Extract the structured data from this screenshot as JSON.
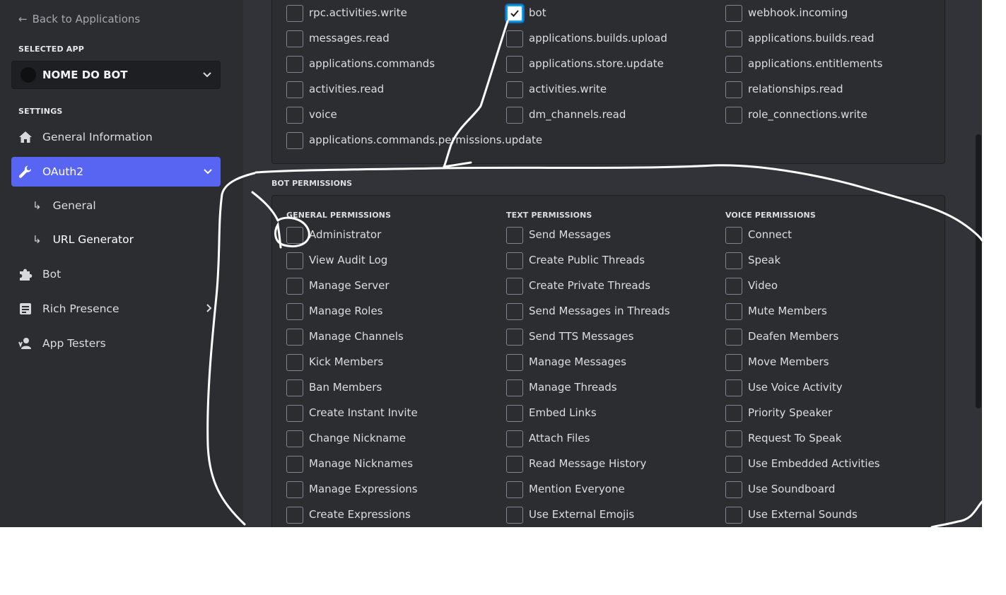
{
  "sidebar": {
    "back_label": "Back to Applications",
    "selected_app_heading": "SELECTED APP",
    "selected_app_name": "NOME DO BOT",
    "settings_heading": "SETTINGS",
    "items": [
      {
        "label": "General Information",
        "icon": "home-icon"
      },
      {
        "label": "OAuth2",
        "icon": "wrench-icon",
        "active": true
      },
      {
        "label": "Bot",
        "icon": "puzzle-icon"
      },
      {
        "label": "Rich Presence",
        "icon": "document-icon"
      },
      {
        "label": "App Testers",
        "icon": "user-icon"
      }
    ],
    "oauth_sub": [
      "General",
      "URL Generator"
    ]
  },
  "scopes": [
    {
      "label": "rpc.activities.write",
      "checked": false
    },
    {
      "label": "bot",
      "checked": true
    },
    {
      "label": "webhook.incoming",
      "checked": false
    },
    {
      "label": "messages.read",
      "checked": false
    },
    {
      "label": "applications.builds.upload",
      "checked": false
    },
    {
      "label": "applications.builds.read",
      "checked": false
    },
    {
      "label": "applications.commands",
      "checked": false
    },
    {
      "label": "applications.store.update",
      "checked": false
    },
    {
      "label": "applications.entitlements",
      "checked": false
    },
    {
      "label": "activities.read",
      "checked": false
    },
    {
      "label": "activities.write",
      "checked": false
    },
    {
      "label": "relationships.read",
      "checked": false
    },
    {
      "label": "voice",
      "checked": false
    },
    {
      "label": "dm_channels.read",
      "checked": false
    },
    {
      "label": "role_connections.write",
      "checked": false
    },
    {
      "label": "applications.commands.permissions.update",
      "checked": false
    }
  ],
  "bot_permissions": {
    "title": "BOT PERMISSIONS",
    "groups": [
      {
        "heading": "GENERAL PERMISSIONS",
        "items": [
          "Administrator",
          "View Audit Log",
          "Manage Server",
          "Manage Roles",
          "Manage Channels",
          "Kick Members",
          "Ban Members",
          "Create Instant Invite",
          "Change Nickname",
          "Manage Nicknames",
          "Manage Expressions",
          "Create Expressions"
        ]
      },
      {
        "heading": "TEXT PERMISSIONS",
        "items": [
          "Send Messages",
          "Create Public Threads",
          "Create Private Threads",
          "Send Messages in Threads",
          "Send TTS Messages",
          "Manage Messages",
          "Manage Threads",
          "Embed Links",
          "Attach Files",
          "Read Message History",
          "Mention Everyone",
          "Use External Emojis"
        ]
      },
      {
        "heading": "VOICE PERMISSIONS",
        "items": [
          "Connect",
          "Speak",
          "Video",
          "Mute Members",
          "Deafen Members",
          "Move Members",
          "Use Voice Activity",
          "Priority Speaker",
          "Request To Speak",
          "Use Embedded Activities",
          "Use Soundboard",
          "Use External Sounds"
        ]
      }
    ]
  },
  "colors": {
    "accent": "#5865f2",
    "sidebar_bg": "#2b2d31",
    "main_bg": "#313338",
    "check_focus": "#00a8fc"
  }
}
